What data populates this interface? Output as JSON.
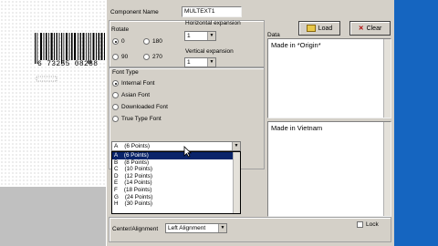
{
  "component_name": {
    "label": "Component Name",
    "value": "MULTEXT1"
  },
  "rotate": {
    "label": "Rotate",
    "options": [
      "0",
      "180",
      "90",
      "270"
    ],
    "selected": "0"
  },
  "horizontal_expansion": {
    "label": "Horizontal  expansion",
    "value": "1"
  },
  "vertical_expansion": {
    "label": "Vertical  expansion",
    "value": "1"
  },
  "buttons": {
    "load": "Load",
    "clear": "Clear"
  },
  "data": {
    "label": "Data",
    "text": "Made in *Origin*"
  },
  "preview_text": "Made in Vietnam",
  "font_type": {
    "label": "Font Type",
    "options": [
      "Internal Font",
      "Asian Font",
      "Downloaded Font",
      "True Type Font"
    ],
    "selected": "Internal Font"
  },
  "font_size": {
    "value": "A    (6 Points)",
    "options": [
      "A    (6 Points)",
      "B    (8 Points)",
      "C    (10 Points)",
      "D    (12 Points)",
      "E    (14 Points)",
      "F    (18 Points)",
      "G    (24 Points)",
      "H    (30 Points)"
    ],
    "highlighted_index": 0
  },
  "center_alignment": {
    "label": "Center/Alignment",
    "value": "Left Alignment"
  },
  "lock": {
    "label": "Lock",
    "checked": false
  },
  "barcode": {
    "digits": "6  73255  08288"
  },
  "colors": {
    "desktop": "#1565c0",
    "dialog": "#d4d0c8",
    "selection": "#0a246a"
  }
}
